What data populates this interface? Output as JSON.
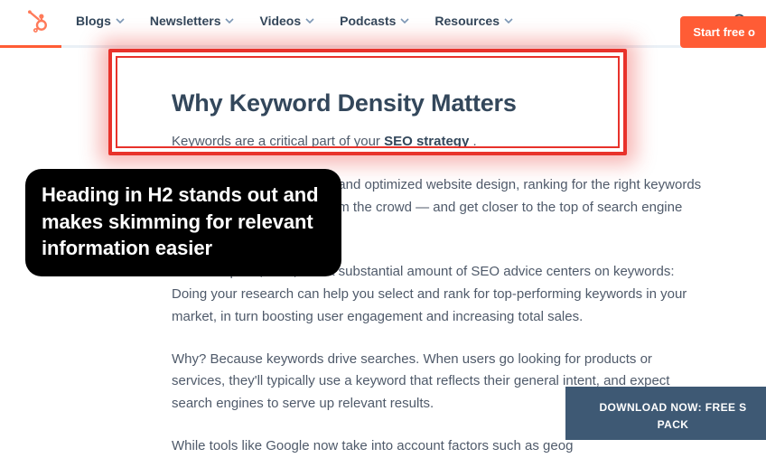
{
  "nav": {
    "items": [
      {
        "label": "Blogs"
      },
      {
        "label": "Newsletters"
      },
      {
        "label": "Videos"
      },
      {
        "label": "Podcasts"
      },
      {
        "label": "Resources"
      }
    ]
  },
  "cta": {
    "label": "Start free o"
  },
  "article": {
    "heading": "Why Keyword Density Matters",
    "lead_prefix": "Keywords are a critical part of your ",
    "lead_strong": "SEO strategy",
    "lead_suffix": " .",
    "p1": "Along with relevant content and optimized website design, ranking for the right keywords helps your site stand out from the crowd — and get closer to the top of search engine results pages (SERPs).",
    "p2": "It's no surprise, then, that a substantial amount of SEO advice centers on keywords: Doing your research can help you select and rank for top-performing keywords in your market, in turn boosting user engagement and increasing total sales.",
    "p3": "Why? Because keywords drive searches. When users go looking for products or services, they'll typically use a keyword that reflects their general intent, and expect search engines to serve up relevant results.",
    "p4": "While tools like Google now take into account factors such as geog"
  },
  "callout": {
    "text": "Heading in H2 stands out and makes skimming for relevant information easier"
  },
  "download": {
    "line1": "DOWNLOAD NOW: FREE S",
    "line2": "PACK"
  },
  "colors": {
    "brand_orange": "#ff5c35",
    "highlight_red": "#e8322b",
    "text_dark": "#33475b",
    "banner_bg": "#3e5974"
  }
}
